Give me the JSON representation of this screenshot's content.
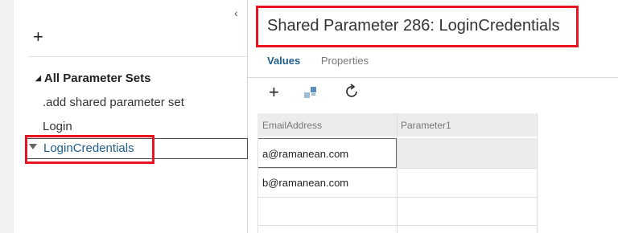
{
  "left_panel": {
    "collapse_icon": "chevron-left-icon",
    "add_icon": "plus-icon",
    "add_label": "+",
    "tree": {
      "root_label": "All Parameter Sets",
      "items": [
        {
          "label": ".add shared parameter set"
        },
        {
          "label": "Login"
        },
        {
          "label": "LoginCredentials",
          "selected": true
        }
      ]
    }
  },
  "header": {
    "title": "Shared Parameter 286: LoginCredentials"
  },
  "tabs": [
    {
      "label": "Values",
      "active": true
    },
    {
      "label": "Properties",
      "active": false
    }
  ],
  "toolbar": {
    "add_label": "+",
    "add_icon": "plus-icon",
    "columns_icon": "manage-columns-icon",
    "refresh_icon": "refresh-icon"
  },
  "grid": {
    "columns": [
      "EmailAddress",
      "Parameter1"
    ],
    "rows": [
      [
        "a@ramanean.com",
        ""
      ],
      [
        "b@ramanean.com",
        ""
      ],
      [
        "",
        ""
      ],
      [
        "",
        ""
      ]
    ]
  },
  "colors": {
    "accent": "#1f5e8c",
    "highlight": "#e8141f",
    "header_bg": "#ececec"
  }
}
